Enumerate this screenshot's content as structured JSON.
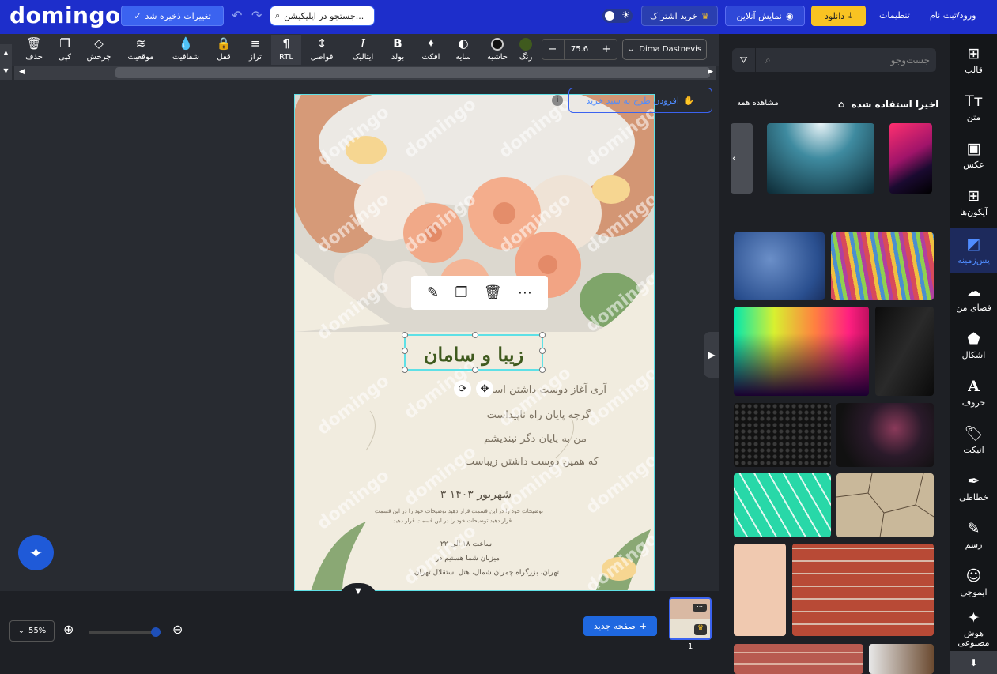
{
  "header": {
    "logo": "domingo",
    "save_label": "تغییرات ذخیره شد",
    "search_placeholder": "جستجو در اپلیکیشن...",
    "subscribe_label": "خرید اشتراک",
    "preview_label": "نمایش آنلاین",
    "download_label": "دانلود",
    "settings_label": "تنظیمات",
    "login_label": "ورود/ثبت نام"
  },
  "toolbar": {
    "font_name": "Dima Dastnevis",
    "font_size": "75.6",
    "tools": {
      "color": "رنگ",
      "border": "حاشیه",
      "shadow": "سایه",
      "effect": "افکت",
      "bold": "بولد",
      "italic": "ایتالیک",
      "spacing": "فواصل",
      "rtl": "RTL",
      "align": "تراز",
      "lock": "قفل",
      "opacity": "شفافیت",
      "position": "موقعیت",
      "rotate": "چرخش",
      "copy": "کپی",
      "delete": "حذف"
    }
  },
  "canvas": {
    "watermark": "domingo",
    "add_to_cart": "افزودن طرح به سبد خرید",
    "invitation": {
      "title": "زیبا و سامان",
      "line1": "آری آغاز دوست داشتن است",
      "line2": "گرچه پایان راه ناپیداست",
      "line3": "من به پایان دگر نیندیشم",
      "line4": "که همین دوست داشتن زیباست",
      "date": "۳ شهریور ۱۴۰۳",
      "desc1": "توضیحات خود را در این قسمت قرار دهید توضیحات خود را در این قسمت",
      "desc2": "قرار دهید توضیحات خود را در این قسمت قرار دهید",
      "time": "ساعت ۱۸ الی ۲۲",
      "host": "میزبان شما هستیم در",
      "address": "تهران، بزرگراه چمران شمال، هتل استقلال تهران"
    }
  },
  "bottom": {
    "zoom": "55%",
    "new_page": "صفحه جدید",
    "page_number": "1"
  },
  "panel": {
    "search_placeholder": "جست‌وجو",
    "recent_title": "اخیرا استفاده شده",
    "see_all": "مشاهده همه"
  },
  "rail": {
    "template": "قالب",
    "text": "متن",
    "photo": "عکس",
    "icons": "آیکون‌ها",
    "background": "پس‌زمینه",
    "myspace": "فضای من",
    "shapes": "اشکال",
    "letters": "حروف",
    "sticker": "اتیکت",
    "calligraphy": "خطاطی",
    "draw": "رسم",
    "emoji": "ایموجی",
    "ai": "هوش مصنوعی"
  },
  "colors": {
    "topbar": "#1d2ecb",
    "accent": "#3b63f0",
    "download": "#f9c322",
    "selection": "#5ee0e6",
    "panel": "#1e2025"
  }
}
